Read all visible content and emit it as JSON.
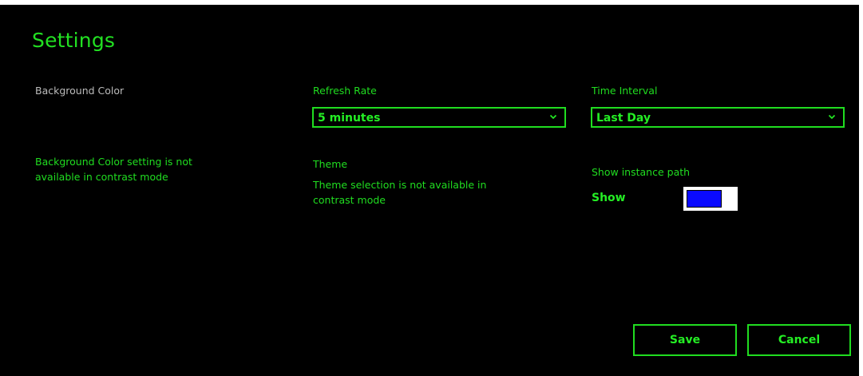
{
  "title": "Settings",
  "background": {
    "label": "Background Color",
    "message": "Background Color setting is not available in contrast mode"
  },
  "refresh": {
    "label": "Refresh Rate",
    "value": "5 minutes"
  },
  "theme": {
    "label": "Theme",
    "message": "Theme selection is not available in contrast mode"
  },
  "interval": {
    "label": "Time Interval",
    "value": "Last Day"
  },
  "instance_path": {
    "label": "Show instance path",
    "toggle_text": "Show",
    "toggle_on": true
  },
  "buttons": {
    "save": "Save",
    "cancel": "Cancel"
  },
  "colors": {
    "background": "#000000",
    "accent": "#24ee24",
    "toggle_track": "#0a0aff"
  }
}
